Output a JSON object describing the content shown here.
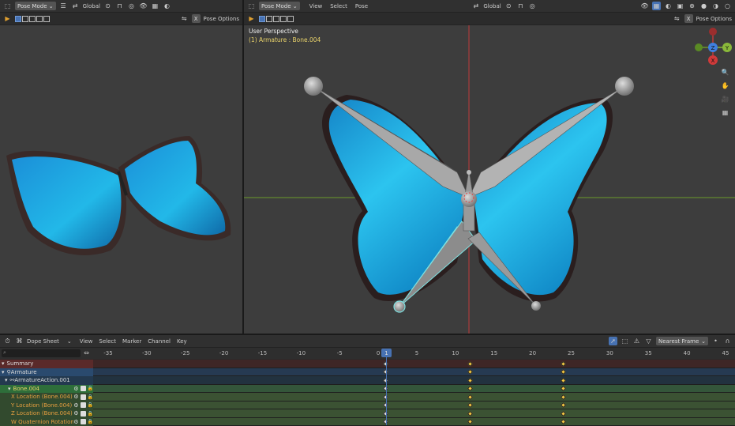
{
  "left_viewport": {
    "mode_label": "Pose Mode",
    "transform_orientation": "Global",
    "pose_options_label": "Pose Options",
    "x_toggle": "X"
  },
  "right_viewport": {
    "mode_label": "Pose Mode",
    "menu": [
      "View",
      "Select",
      "Pose"
    ],
    "transform_orientation": "Global",
    "pose_options_label": "Pose Options",
    "x_toggle": "X",
    "perspective_label": "User Perspective",
    "active_object_label": "(1) Armature : Bone.004",
    "gizmo": {
      "z": "Z",
      "y": "Y",
      "x": "X"
    }
  },
  "dope_sheet": {
    "editor_label": "Dope Sheet",
    "menu": [
      "View",
      "Select",
      "Marker",
      "Channel",
      "Key"
    ],
    "snap_label": "Nearest Frame",
    "current_frame": "1",
    "ruler_ticks": [
      "-35",
      "-30",
      "-25",
      "-20",
      "-15",
      "-10",
      "-5",
      "0",
      "5",
      "10",
      "15",
      "20",
      "25",
      "30",
      "35",
      "40",
      "45"
    ],
    "channels": [
      {
        "label": "Summary",
        "kind": "summary"
      },
      {
        "label": "Armature",
        "kind": "object"
      },
      {
        "label": "ArmatureAction.001",
        "kind": "action"
      },
      {
        "label": "Bone.004",
        "kind": "group"
      },
      {
        "label": "X Location (Bone.004)",
        "kind": "fcurve"
      },
      {
        "label": "Y Location (Bone.004)",
        "kind": "fcurve"
      },
      {
        "label": "Z Location (Bone.004)",
        "kind": "fcurve"
      },
      {
        "label": "W Quaternion Rotation (B",
        "kind": "fcurve"
      }
    ],
    "keyframes": [
      1,
      12,
      24
    ]
  },
  "colors": {
    "accent": "#4772b3",
    "active_bone_outline": "#7fe0e0",
    "keyframe": "#f5c842",
    "x_axis": "#c03a3a",
    "y_axis": "#6b9a2a"
  }
}
